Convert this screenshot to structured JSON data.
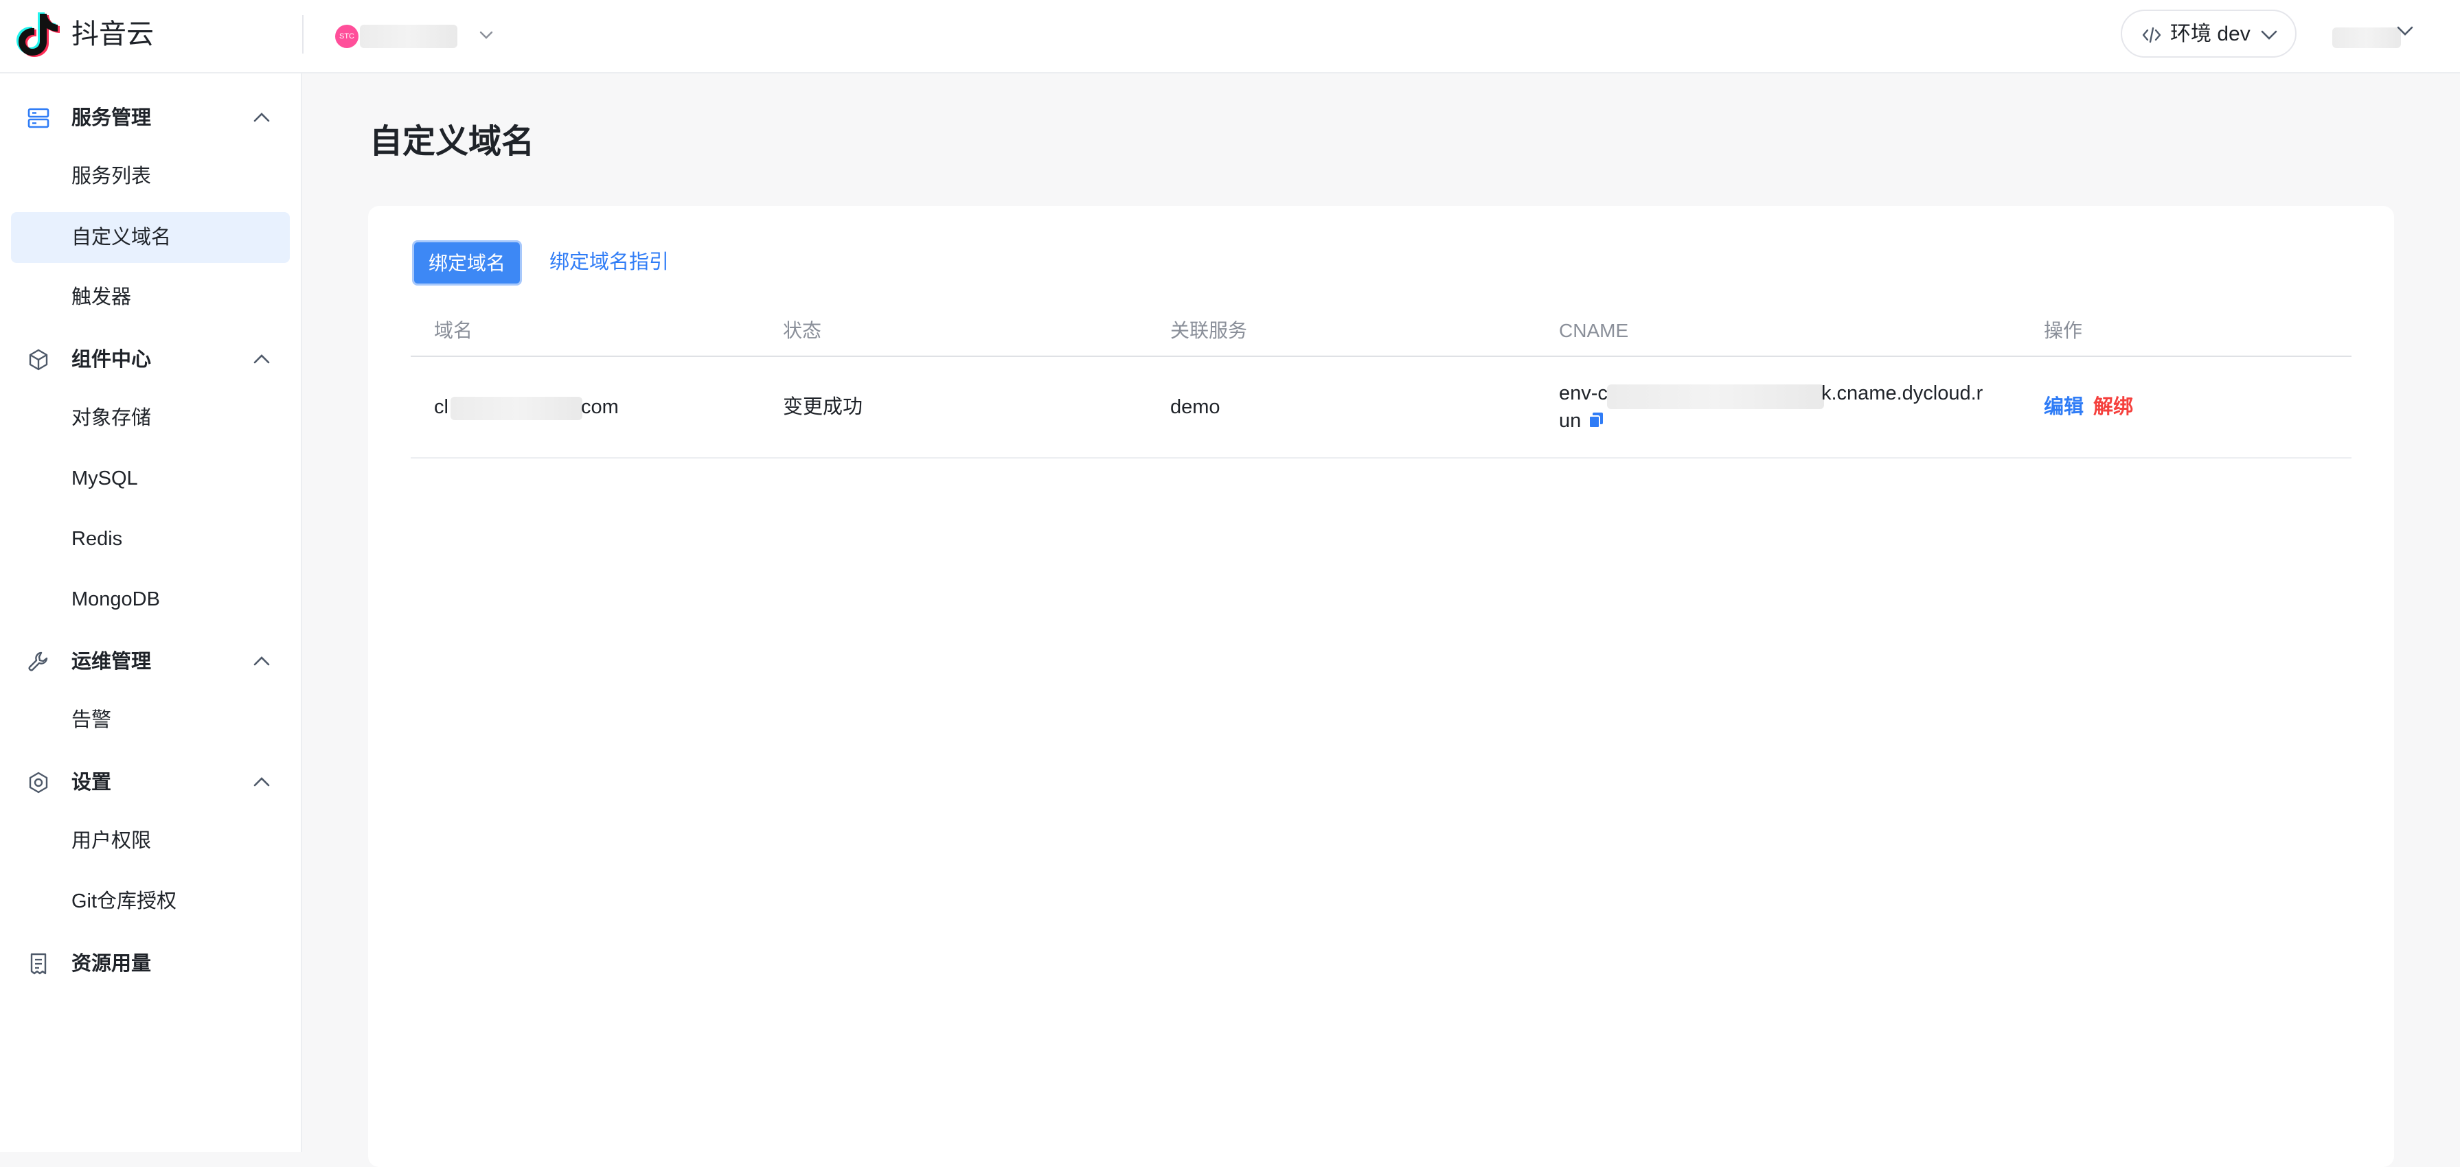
{
  "header": {
    "app_title": "抖音云",
    "project_avatar_text": "STC",
    "env_label": "环境 dev"
  },
  "sidebar": {
    "groups": [
      {
        "label": "服务管理",
        "icon": "server-icon",
        "items": [
          {
            "label": "服务列表"
          },
          {
            "label": "自定义域名"
          },
          {
            "label": "触发器"
          }
        ]
      },
      {
        "label": "组件中心",
        "icon": "component-icon",
        "items": [
          {
            "label": "对象存储"
          },
          {
            "label": "MySQL"
          },
          {
            "label": "Redis"
          },
          {
            "label": "MongoDB"
          }
        ]
      },
      {
        "label": "运维管理",
        "icon": "wrench-icon",
        "items": [
          {
            "label": "告警"
          }
        ]
      },
      {
        "label": "设置",
        "icon": "settings-icon",
        "items": [
          {
            "label": "用户权限"
          },
          {
            "label": "Git仓库授权"
          }
        ]
      },
      {
        "label": "资源用量",
        "icon": "bill-icon",
        "items": []
      }
    ],
    "active_item": "自定义域名"
  },
  "main": {
    "page_title": "自定义域名",
    "bind_button": "绑定域名",
    "guide_link": "绑定域名指引",
    "table": {
      "columns": [
        "域名",
        "状态",
        "关联服务",
        "CNAME",
        "操作"
      ],
      "rows": [
        {
          "domain_prefix": "cl",
          "domain_suffix": "com",
          "status": "变更成功",
          "service": "demo",
          "cname_prefix": "env-c",
          "cname_suffix": "k.cname.dycloud.r",
          "cname_line2": "un",
          "actions": {
            "edit": "编辑",
            "unbind": "解绑"
          }
        }
      ]
    }
  },
  "colors": {
    "primary": "#3d88f5",
    "link": "#2f7cf6",
    "danger": "#f5403d",
    "active_bg": "#e8f1fe"
  }
}
